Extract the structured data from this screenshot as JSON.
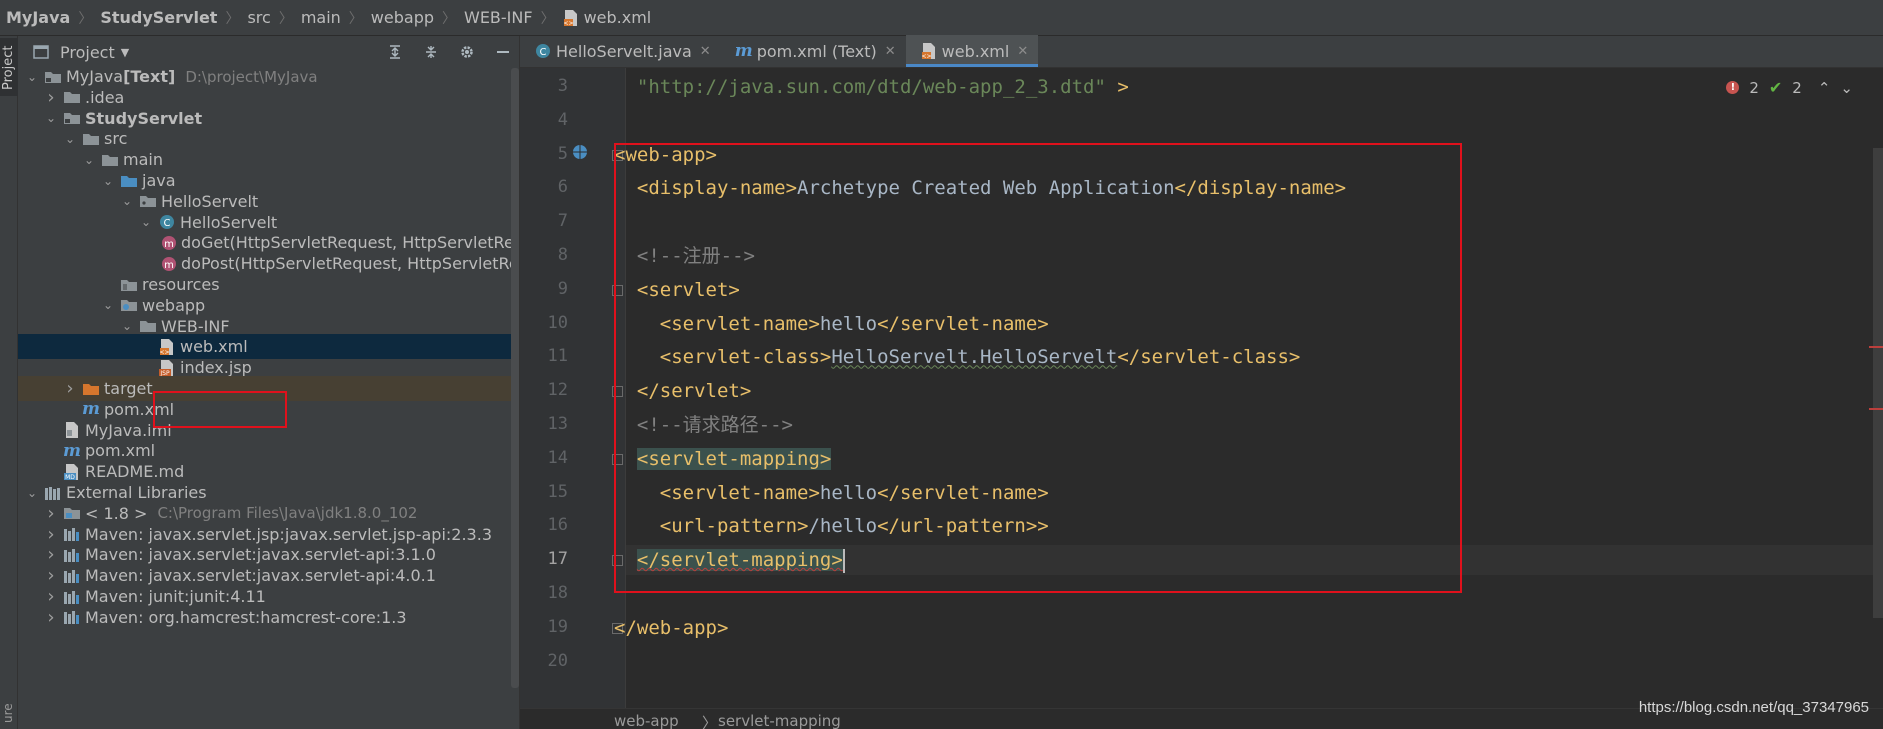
{
  "breadcrumb": [
    {
      "label": "MyJava",
      "bold": true
    },
    {
      "label": "StudyServlet",
      "bold": true
    },
    {
      "label": "src"
    },
    {
      "label": "main"
    },
    {
      "label": "webapp"
    },
    {
      "label": "WEB-INF"
    },
    {
      "label": "web.xml",
      "icon": "xml-file-icon"
    }
  ],
  "side_strip": {
    "project_tab": "Project",
    "bottom_tab": "ure"
  },
  "project": {
    "title": "Project",
    "tree": [
      {
        "label": "MyJava",
        "extra": " [Text]",
        "muted": "D:\\project\\MyJava",
        "icon": "folder-module-icon",
        "arrow": "down"
      },
      {
        "label": ".idea",
        "icon": "folder-icon",
        "arrow": "right"
      },
      {
        "label": "StudyServlet",
        "icon": "folder-module-icon",
        "arrow": "down",
        "bold": true
      },
      {
        "label": "src",
        "icon": "folder-icon",
        "arrow": "down"
      },
      {
        "label": "main",
        "icon": "folder-icon",
        "arrow": "down"
      },
      {
        "label": "java",
        "icon": "source-folder-icon",
        "arrow": "down"
      },
      {
        "label": "HelloServelt",
        "icon": "package-icon",
        "arrow": "down"
      },
      {
        "label": "HelloServelt",
        "icon": "class-icon",
        "arrow": "down"
      },
      {
        "label": "doGet(HttpServletRequest, HttpServletResponse)",
        "icon": "method-icon"
      },
      {
        "label": "doPost(HttpServletRequest, HttpServletResponse)",
        "icon": "method-icon"
      },
      {
        "label": "resources",
        "icon": "resources-folder-icon"
      },
      {
        "label": "webapp",
        "icon": "web-folder-icon",
        "arrow": "down"
      },
      {
        "label": "WEB-INF",
        "icon": "folder-icon",
        "arrow": "down"
      },
      {
        "label": "web.xml",
        "icon": "xml-file-icon",
        "selected": true
      },
      {
        "label": "index.jsp",
        "icon": "jsp-file-icon"
      },
      {
        "label": "target",
        "icon": "excluded-folder-icon",
        "arrow": "right",
        "target": true
      },
      {
        "label": "pom.xml",
        "icon": "maven-icon"
      },
      {
        "label": "MyJava.iml",
        "icon": "iml-file-icon"
      },
      {
        "label": "pom.xml",
        "icon": "maven-icon"
      },
      {
        "label": "README.md",
        "icon": "markdown-icon"
      },
      {
        "label": "External Libraries",
        "icon": "libraries-icon",
        "arrow": "down"
      },
      {
        "label": "< 1.8 >",
        "muted": "C:\\Program Files\\Java\\jdk1.8.0_102",
        "icon": "jdk-icon",
        "arrow": "right"
      },
      {
        "label": "Maven: javax.servlet.jsp:javax.servlet.jsp-api:2.3.3",
        "icon": "library-icon",
        "arrow": "right"
      },
      {
        "label": "Maven: javax.servlet:javax.servlet-api:3.1.0",
        "icon": "library-icon",
        "arrow": "right"
      },
      {
        "label": "Maven: javax.servlet:javax.servlet-api:4.0.1",
        "icon": "library-icon",
        "arrow": "right"
      },
      {
        "label": "Maven: junit:junit:4.11",
        "icon": "library-icon",
        "arrow": "right"
      },
      {
        "label": "Maven: org.hamcrest:hamcrest-core:1.3",
        "icon": "library-icon",
        "arrow": "right"
      }
    ]
  },
  "tabs": [
    {
      "label": "HelloServelt.java",
      "icon": "class-icon"
    },
    {
      "label": "pom.xml (Text)",
      "icon": "maven-icon"
    },
    {
      "label": "web.xml",
      "icon": "xml-file-icon",
      "active": true
    }
  ],
  "inspections": {
    "errors": "2",
    "ok": "2"
  },
  "editor": {
    "lines": [
      {
        "n": "3",
        "parts": [
          {
            "t": "  ",
            "c": "txt"
          },
          {
            "t": "\"http://java.sun.com/dtd/web-app_2_3.dtd\"",
            "c": "str"
          },
          {
            "t": " >",
            "c": "tag"
          }
        ]
      },
      {
        "n": "4",
        "parts": []
      },
      {
        "n": "5",
        "parts": [
          {
            "t": "<web-app>",
            "c": "tag"
          }
        ]
      },
      {
        "n": "6",
        "parts": [
          {
            "t": "  <display-name>",
            "c": "tag"
          },
          {
            "t": "Archetype Created Web Application",
            "c": "txt"
          },
          {
            "t": "</display-name>",
            "c": "tag"
          }
        ]
      },
      {
        "n": "7",
        "parts": []
      },
      {
        "n": "8",
        "parts": [
          {
            "t": "  <!--注册-->",
            "c": "cmt"
          }
        ]
      },
      {
        "n": "9",
        "parts": [
          {
            "t": "  <servlet>",
            "c": "tag"
          }
        ]
      },
      {
        "n": "10",
        "parts": [
          {
            "t": "    <servlet-name>",
            "c": "tag"
          },
          {
            "t": "hello",
            "c": "txt"
          },
          {
            "t": "</servlet-name>",
            "c": "tag"
          }
        ]
      },
      {
        "n": "11",
        "parts": [
          {
            "t": "    <servlet-class>",
            "c": "tag"
          },
          {
            "t": "HelloServelt.HelloServelt",
            "c": "txt"
          },
          {
            "t": "</servlet-class>",
            "c": "tag"
          }
        ]
      },
      {
        "n": "12",
        "parts": [
          {
            "t": "  </servlet>",
            "c": "tag"
          }
        ]
      },
      {
        "n": "13",
        "parts": [
          {
            "t": "  <!--请求路径-->",
            "c": "cmt"
          }
        ]
      },
      {
        "n": "14",
        "parts": [
          {
            "t": "  ",
            "c": "txt"
          },
          {
            "t": "<servlet-mapping>",
            "c": "tag",
            "hl": true
          }
        ]
      },
      {
        "n": "15",
        "parts": [
          {
            "t": "    <servlet-name>",
            "c": "tag"
          },
          {
            "t": "hello",
            "c": "txt"
          },
          {
            "t": "</servlet-name>",
            "c": "tag"
          }
        ]
      },
      {
        "n": "16",
        "parts": [
          {
            "t": "    <url-pattern>",
            "c": "tag"
          },
          {
            "t": "/hello",
            "c": "txt"
          },
          {
            "t": "</url-pattern>>",
            "c": "tag"
          }
        ]
      },
      {
        "n": "17",
        "parts": [
          {
            "t": "  ",
            "c": "txt"
          },
          {
            "t": "</servlet-mapping>",
            "c": "tag",
            "hl": true
          }
        ],
        "current": true
      },
      {
        "n": "18",
        "parts": []
      },
      {
        "n": "19",
        "parts": [
          {
            "t": "</web-app>",
            "c": "tag"
          }
        ]
      },
      {
        "n": "20",
        "parts": []
      }
    ]
  },
  "footer": {
    "path": [
      "web-app",
      "servlet-mapping"
    ]
  },
  "watermark": "https://blog.csdn.net/qq_37347965"
}
